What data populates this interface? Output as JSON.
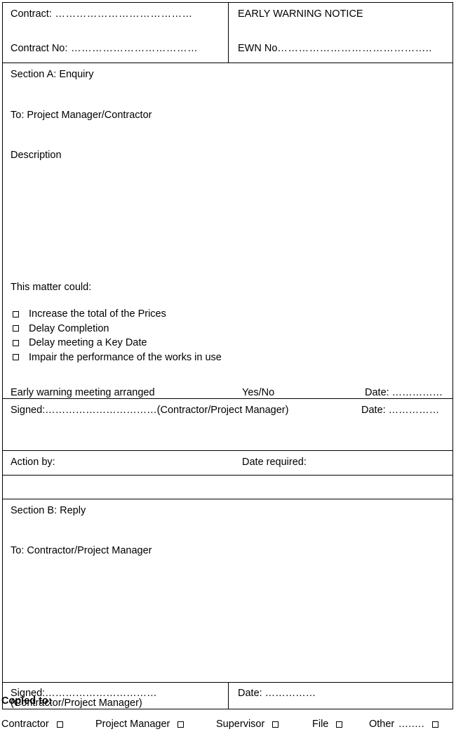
{
  "document": {
    "title": "EARLY WARNING NOTICE"
  },
  "header": {
    "contract_label": "Contract:",
    "contract_dots": " …………………………………",
    "contract_no_label": "Contract No:",
    "contract_no_dots": " ………………………………",
    "notice_title": "EARLY WARNING NOTICE",
    "ewn_no_label": "EWN No",
    "ewn_no_dots": "…………………………………….."
  },
  "section_a": {
    "heading": "Section A: Enquiry",
    "to_label": "To: Project Manager/Contractor",
    "description_label": "Description",
    "matter_label": "This matter could:",
    "checkboxes": [
      {
        "label": "Increase the total of the Prices",
        "checked": false
      },
      {
        "label": "Delay Completion",
        "checked": false
      },
      {
        "label": "Delay meeting a Key Date",
        "checked": false
      },
      {
        "label": "Impair the performance of the works in use",
        "checked": false
      }
    ],
    "meeting_label": "Early warning meeting arranged",
    "meeting_answer": "Yes/No",
    "meeting_date_label": "Date: ……………",
    "signed_label": "Signed:……………………………(Contractor/Project Manager)",
    "signed_date_label": "Date: ……………",
    "action_by_label": "Action by:",
    "date_required_label": "Date required:"
  },
  "section_b": {
    "heading": "Section B: Reply",
    "to_label": "To: Contractor/Project Manager",
    "signed_label": "Signed:……………………………(Contractor/Project Manager)",
    "signed_date_label": "Date: ……………"
  },
  "copied_to": {
    "title": "Copied to:",
    "items": [
      {
        "label": "Contractor",
        "dots": "",
        "checked": false
      },
      {
        "label": "Project Manager",
        "dots": "",
        "checked": false
      },
      {
        "label": "Supervisor",
        "dots": "",
        "checked": false
      },
      {
        "label": "File",
        "dots": "",
        "checked": false
      },
      {
        "label": "Other",
        "dots": "........",
        "checked": false
      }
    ]
  },
  "colors": {
    "border": "#000000",
    "text": "#000000",
    "background": "#ffffff"
  }
}
